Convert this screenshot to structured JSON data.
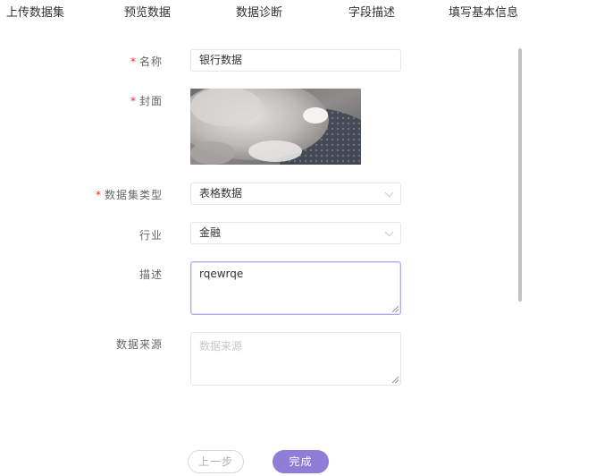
{
  "steps": [
    "上传数据集",
    "预览数据",
    "数据诊断",
    "字段描述",
    "填写基本信息"
  ],
  "form": {
    "name_label": "名称",
    "name_value": "银行数据",
    "cover_label": "封面",
    "dataset_type_label": "数据集类型",
    "dataset_type_value": "表格数据",
    "industry_label": "行业",
    "industry_value": "金融",
    "description_label": "描述",
    "description_value": "rqewrqe",
    "source_label": "数据来源",
    "source_placeholder": "数据来源",
    "required_mark": "*"
  },
  "buttons": {
    "prev": "上一步",
    "done": "完成"
  },
  "colors": {
    "accent": "#8f7ed8",
    "required": "#f5222d"
  }
}
